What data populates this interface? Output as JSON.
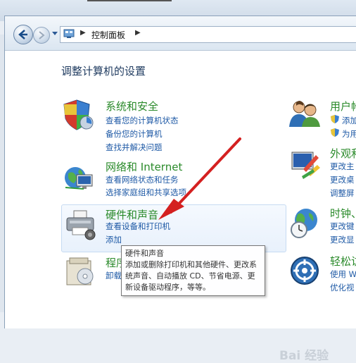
{
  "address_bar": {
    "path": [
      "控制面板"
    ]
  },
  "page_title": "调整计算机的设置",
  "categories_left": [
    {
      "title": "系统和安全",
      "icon": "shield-icon",
      "links": [
        "查看您的计算机状态",
        "备份您的计算机",
        "查找并解决问题"
      ]
    },
    {
      "title": "网络和 Internet",
      "icon": "network-globe-icon",
      "links": [
        "查看网络状态和任务",
        "选择家庭组和共享选项"
      ]
    },
    {
      "title": "硬件和声音",
      "icon": "printer-icon",
      "links": [
        "查看设备和打印机",
        "添加"
      ]
    },
    {
      "title": "程序",
      "icon": "programs-icon",
      "links": [
        "卸载"
      ]
    }
  ],
  "categories_right": [
    {
      "title": "用户帐",
      "icon": "users-icon",
      "links": [
        "添加",
        "为用"
      ]
    },
    {
      "title": "外观和",
      "icon": "appearance-icon",
      "links": [
        "更改主",
        "更改桌",
        "调整屏"
      ]
    },
    {
      "title": "时钟、",
      "icon": "clock-globe-icon",
      "links": [
        "更改键",
        "更改显"
      ]
    },
    {
      "title": "轻松访",
      "icon": "ease-of-access-icon",
      "links": [
        "使用 W",
        "优化视"
      ]
    }
  ],
  "tooltip": {
    "title": "硬件和声音",
    "body": "添加或删除打印机和其他硬件、更改系统声音、自动播放 CD、节省电源、更新设备驱动程序，等等。"
  },
  "watermark": "Bai 经验",
  "colors": {
    "category_title": "#2a8a2a",
    "link": "#1f5aa6",
    "arrow": "#d42020",
    "page_title": "#1e3a5f"
  }
}
